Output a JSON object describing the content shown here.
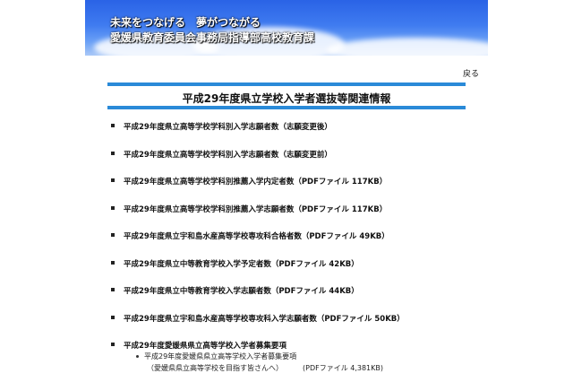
{
  "header": {
    "line1": "未来をつなげる　夢がつながる",
    "line2": "愛媛県教育委員会事務局指導部高校教育課"
  },
  "nav": {
    "back_label": "戻る"
  },
  "page_title": "平成29年度県立学校入学者選抜等関連情報",
  "items": [
    "平成29年度県立高等学校学科別入学志願者数（志願変更後）",
    "平成29年度県立高等学校学科別入学志願者数（志願変更前）",
    "平成29年度県立高等学校学科別推薦入学内定者数（PDFファイル 117KB）",
    "平成29年度県立高等学校学科別推薦入学志願者数（PDFファイル 117KB）",
    "平成29年度県立宇和島水産高等学校専攻科合格者数（PDFファイル 49KB）",
    "平成29年度県立中等教育学校入学予定者数（PDFファイル 42KB）",
    "平成29年度県立中等教育学校入学志願者数（PDFファイル 44KB）",
    "平成29年度県立宇和島水産高等学校専攻科入学志願者数（PDFファイル 50KB）",
    "平成29年度愛媛県県立高等学校入学者募集要項"
  ],
  "sub_item": {
    "line1": "平成29年度愛媛県県立高等学校入学者募集要項",
    "line2": "（愛媛県県立高等学校を目指す皆さんへ）",
    "pdf": "(PDFファイル 4,381KB)"
  }
}
